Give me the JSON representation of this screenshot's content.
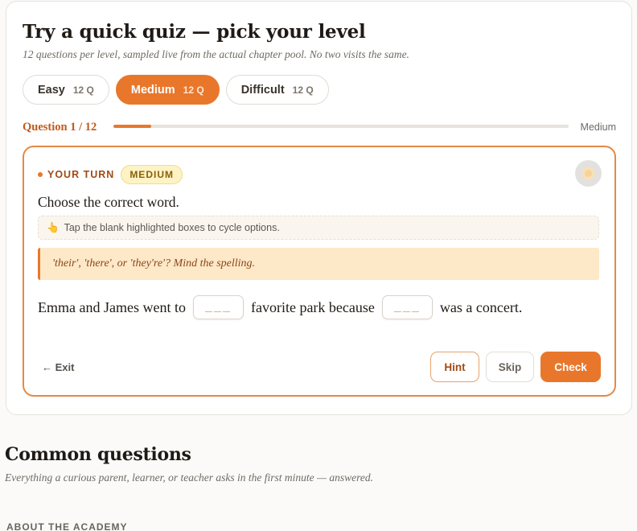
{
  "quiz": {
    "title": "Try a quick quiz — pick your level",
    "subtitle": "12 questions per level, sampled live from the actual chapter pool. No two visits the same.",
    "levels": [
      {
        "label": "Easy",
        "count": "12 Q",
        "active": false
      },
      {
        "label": "Medium",
        "count": "12 Q",
        "active": true
      },
      {
        "label": "Difficult",
        "count": "12 Q",
        "active": false
      }
    ],
    "progress": {
      "label": "Question 1 / 12",
      "fraction": 0.083,
      "level": "Medium"
    },
    "question": {
      "turn_label": "YOUR TURN",
      "difficulty_badge": "MEDIUM",
      "prompt": "Choose the correct word.",
      "tip_icon": "👆",
      "tip": "Tap the blank highlighted boxes to cycle options.",
      "clue": "'their', 'there', or 'they're'? Mind the spelling.",
      "sentence": {
        "part1": "Emma and James went to",
        "blank1": "___",
        "part2": "favorite park because",
        "blank2": "___",
        "part3": "was a concert."
      }
    },
    "actions": {
      "exit": "← Exit",
      "hint": "Hint",
      "skip": "Skip",
      "check": "Check"
    }
  },
  "faq": {
    "title": "Common questions",
    "subtitle": "Everything a curious parent, learner, or teacher asks in the first minute — answered.",
    "section_label": "ABOUT THE ACADEMY"
  },
  "colors": {
    "accent": "#e9772b",
    "accent_dark": "#c05a1b",
    "badge_bg": "#fdf3c4",
    "clue_bg": "#fde8c8"
  },
  "icons": {
    "audio": "audio-icon",
    "tip": "pointing-hand-icon",
    "exit": "left-arrow-icon"
  }
}
